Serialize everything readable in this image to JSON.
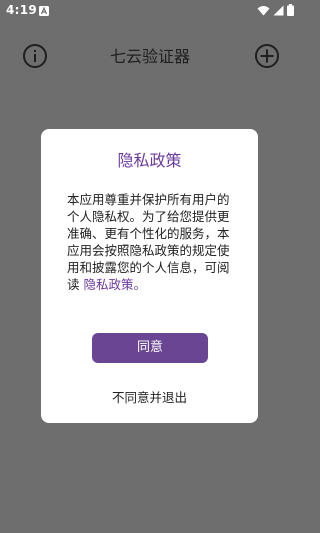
{
  "status_bar": {
    "time": "4:19"
  },
  "app_bar": {
    "title": "七云验证器"
  },
  "dialog": {
    "title": "隐私政策",
    "body": "本应用尊重并保护所有用户的个人隐私权。为了给您提供更准确、更有个性化的服务，本应用会按照隐私政策的规定使用和披露您的个人信息，可阅读",
    "link": "隐私政策。",
    "agree_label": "同意",
    "disagree_label": "不同意并退出"
  },
  "colors": {
    "accent": "#6b3aa0",
    "button": "#6a4594",
    "scrim": "#6e6e6e"
  }
}
